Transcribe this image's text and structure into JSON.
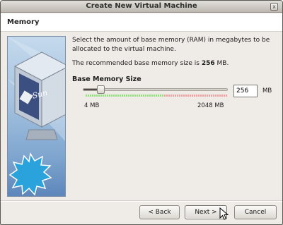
{
  "window": {
    "title": "Create New Virtual Machine",
    "close_glyph": "x"
  },
  "page": {
    "title": "Memory"
  },
  "content": {
    "description": "Select the amount of base memory (RAM) in megabytes to be allocated to the virtual machine.",
    "recommended_prefix": "The recommended base memory size is ",
    "recommended_value": "256",
    "recommended_suffix": " MB.",
    "size_label": "Base Memory Size"
  },
  "memory": {
    "value": "256",
    "unit": "MB",
    "min_label": "4 MB",
    "max_label": "2048 MB",
    "slider_fraction": 0.125,
    "safe_fraction": 0.55
  },
  "buttons": {
    "back": "< Back",
    "next": "Next >",
    "cancel": "Cancel"
  },
  "side_image": {
    "logo_text": "Sun"
  },
  "colors": {
    "safe_range": "#9ddc86",
    "warn_range": "#f0a3a3"
  }
}
